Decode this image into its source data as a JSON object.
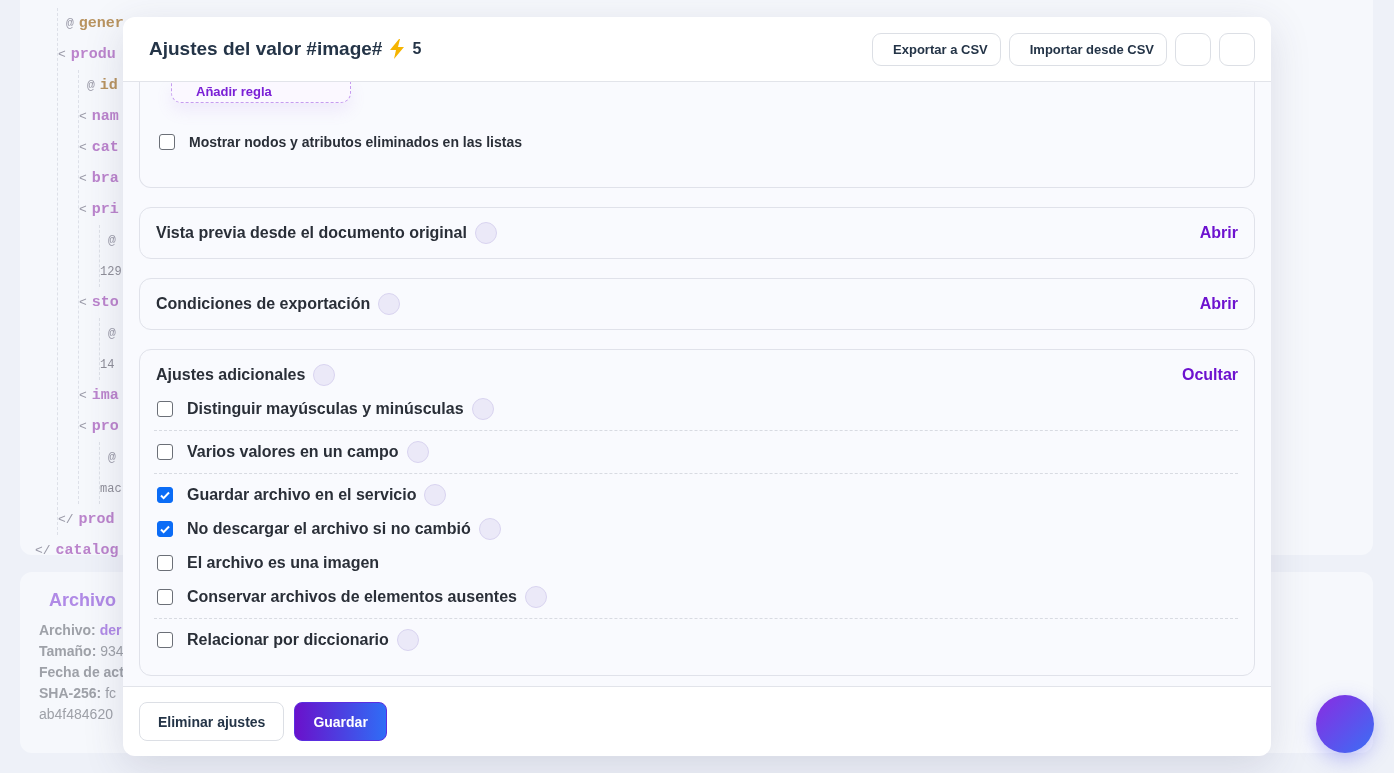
{
  "code_lines": [
    {
      "kind": "scrolled",
      "children": [
        {
          "kind": "attr",
          "marker": "@",
          "name": "gener"
        },
        {
          "kind": "open",
          "marker": "<",
          "name": "produ",
          "children": [
            {
              "kind": "attr",
              "marker": "@",
              "name": "id"
            },
            {
              "kind": "open",
              "marker": "<",
              "name": "nam"
            },
            {
              "kind": "open",
              "marker": "<",
              "name": "cat"
            },
            {
              "kind": "open",
              "marker": "<",
              "name": "bra"
            },
            {
              "kind": "open",
              "marker": "<",
              "name": "pri",
              "children": [
                {
                  "kind": "attr",
                  "marker": "@"
                },
                {
                  "kind": "text",
                  "name": "129"
                }
              ]
            },
            {
              "kind": "open",
              "marker": "<",
              "name": "sto",
              "children": [
                {
                  "kind": "attr",
                  "marker": "@"
                },
                {
                  "kind": "text",
                  "name": "14"
                }
              ]
            },
            {
              "kind": "open",
              "marker": "<",
              "name": "ima"
            },
            {
              "kind": "open",
              "marker": "<",
              "name": "pro",
              "children": [
                {
                  "kind": "attr",
                  "marker": "@"
                },
                {
                  "kind": "text",
                  "name": "mac"
                }
              ]
            }
          ]
        },
        {
          "kind": "close",
          "marker": "</",
          "name": "prod"
        }
      ]
    },
    {
      "kind": "close",
      "marker": "</",
      "name": "catalog"
    }
  ],
  "file_card": {
    "title": "Archivo",
    "rows": [
      {
        "label": "Archivo:",
        "value": "der",
        "kind": "link"
      },
      {
        "label": "Tamaño:",
        "value": "934",
        "kind": "plain"
      },
      {
        "label": "Fecha de act"
      },
      {
        "label": "SHA-256:",
        "value": "fc",
        "kind": "plain"
      },
      {
        "value": "ab4f484620",
        "kind": "plain"
      }
    ]
  },
  "modal": {
    "title": "Ajustes del valor #image#",
    "count": "5",
    "header_buttons": [
      {
        "kind": "text",
        "label": "Exportar a CSV"
      },
      {
        "kind": "text",
        "label": "Importar desde CSV"
      },
      {
        "kind": "icon"
      },
      {
        "kind": "icon"
      }
    ],
    "rules_card": {
      "add_rule": "Añadir regla",
      "option": {
        "label": "Mostrar nodos y atributos eliminados en las listas",
        "checked": false
      }
    },
    "sections": [
      {
        "title": "Vista previa desde el documento original",
        "action": "Abrir"
      },
      {
        "title": "Condiciones de exportación",
        "action": "Abrir"
      },
      {
        "title": "Ajustes adicionales",
        "action": "Ocultar",
        "groups": [
          [
            {
              "label": "Distinguir mayúsculas y minúsculas",
              "checked": false,
              "info": true
            }
          ],
          [
            {
              "label": "Varios valores en un campo",
              "checked": false,
              "info": true
            }
          ],
          [
            {
              "label": "Guardar archivo en el servicio",
              "checked": true,
              "info": true
            },
            {
              "label": "No descargar el archivo si no cambió",
              "checked": true,
              "info": true
            },
            {
              "label": "El archivo es una imagen",
              "checked": false,
              "info": false
            },
            {
              "label": "Conservar archivos de elementos ausentes",
              "checked": false,
              "info": true
            }
          ],
          [
            {
              "label": "Relacionar por diccionario",
              "checked": false,
              "info": true
            }
          ]
        ]
      }
    ],
    "footer_buttons": [
      {
        "label": "Eliminar ajustes",
        "kind": "secondary"
      },
      {
        "label": "Guardar",
        "kind": "primary"
      }
    ]
  }
}
